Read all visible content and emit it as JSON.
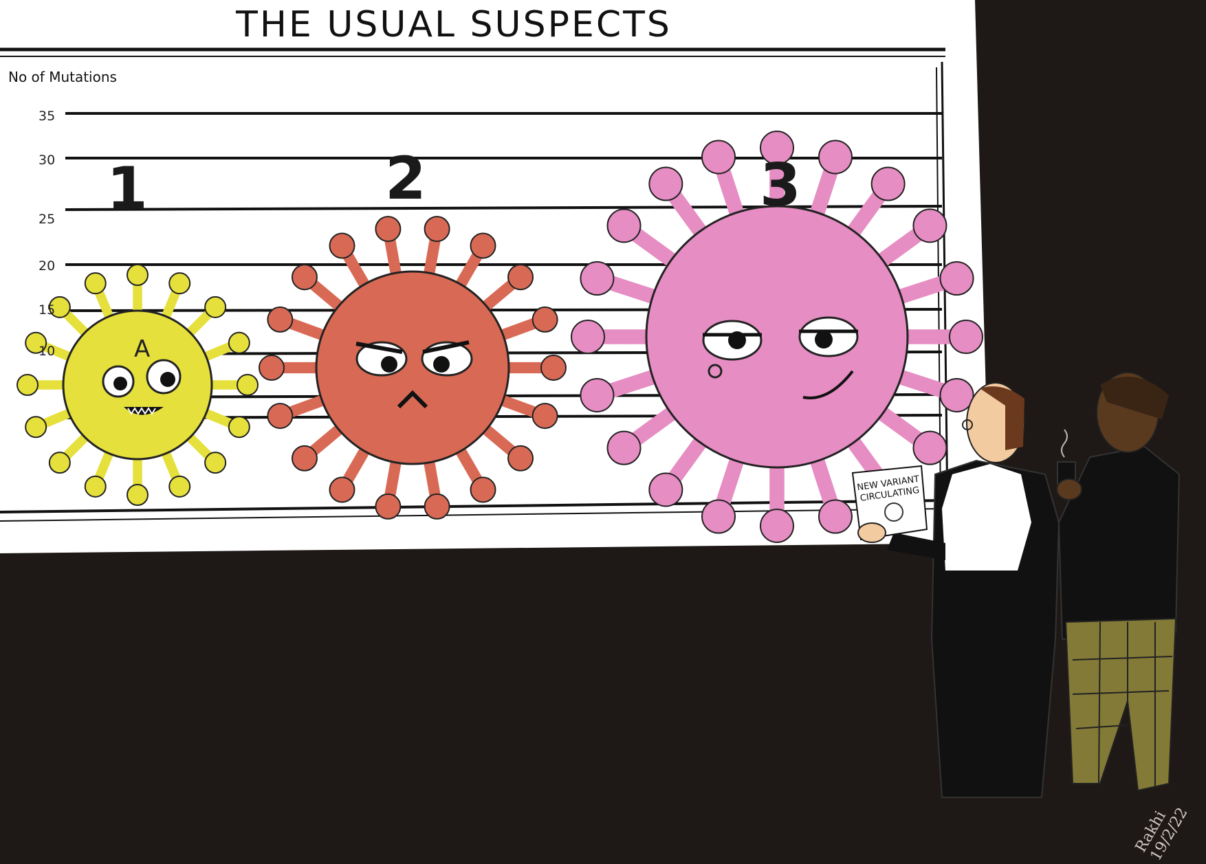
{
  "title": "THE USUAL SUSPECTS",
  "axis": {
    "label": "No of Mutations",
    "ticks": [
      "35",
      "30",
      "25",
      "20",
      "15",
      "10"
    ]
  },
  "suspects": [
    {
      "number": "1",
      "color": "#e6e03c",
      "letter": "A"
    },
    {
      "number": "2",
      "color": "#d86a55"
    },
    {
      "number": "3",
      "color": "#e68dc3"
    }
  ],
  "sign": {
    "line1": "NEW VARIANT",
    "line2": "CIRCULATING"
  },
  "signature": {
    "name": "Rakhi",
    "date": "19/2/22"
  },
  "colors": {
    "background": "#1e1917",
    "board": "#ffffff",
    "line": "#111111"
  }
}
